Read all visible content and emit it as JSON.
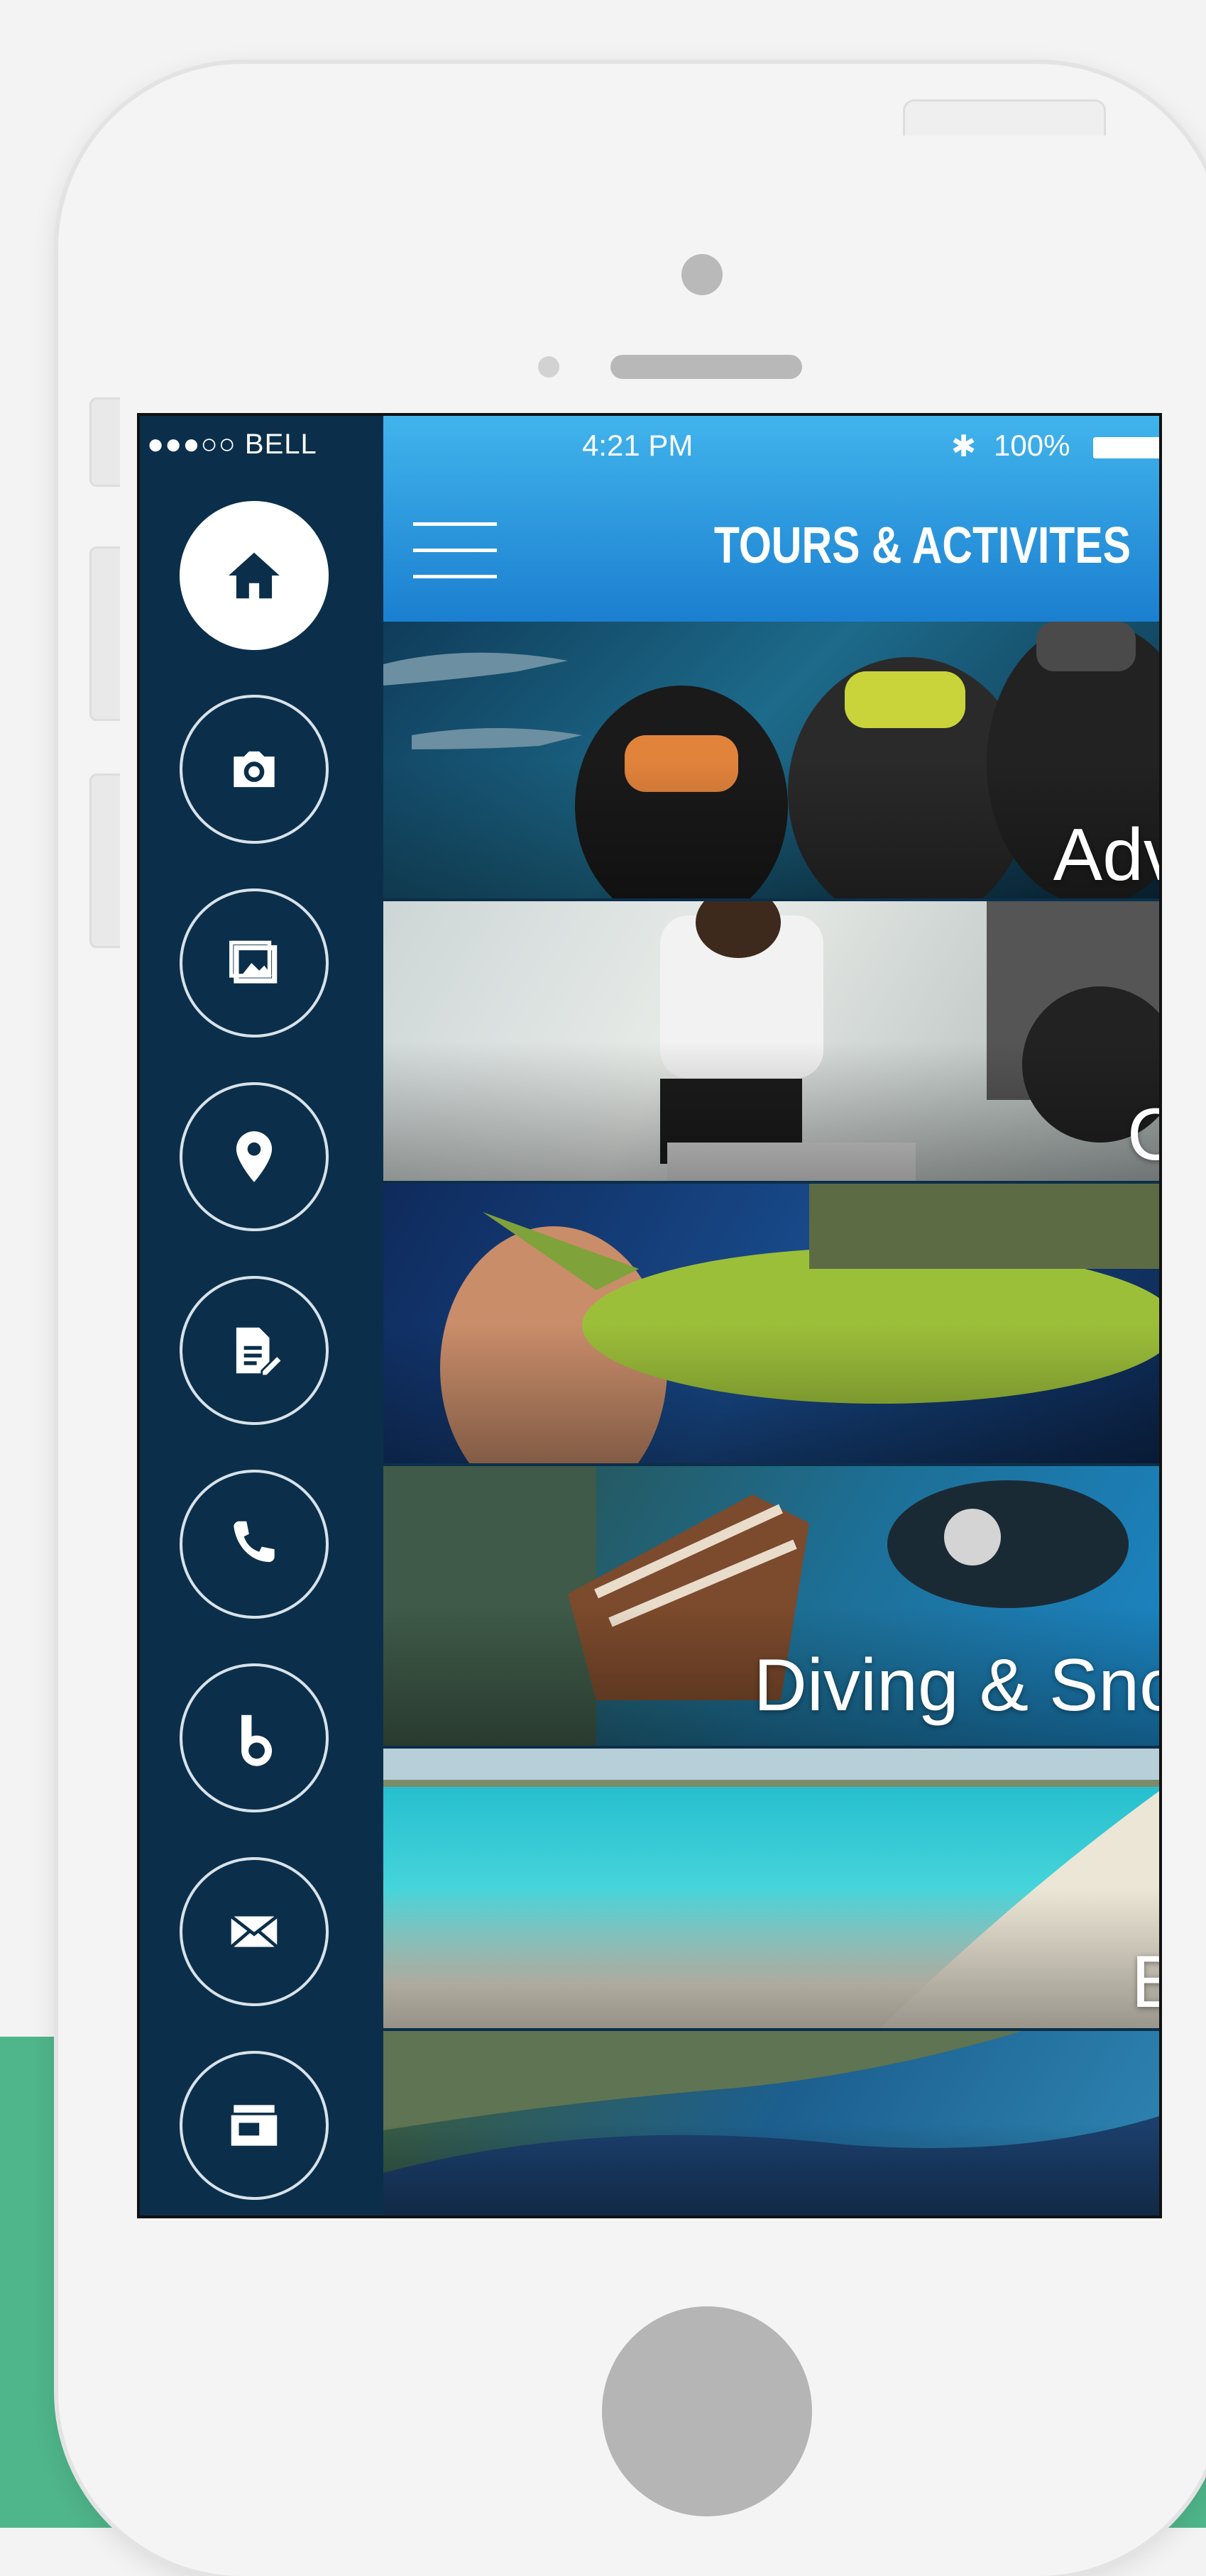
{
  "status": {
    "carrier": "●●●○○ BELL",
    "time": "4:21 PM",
    "battery": "100%"
  },
  "header": {
    "title": "TOURS & ACTIVITES"
  },
  "sidebar": {
    "items": [
      {
        "icon": "home-icon",
        "active": true
      },
      {
        "icon": "camera-icon"
      },
      {
        "icon": "gallery-icon"
      },
      {
        "icon": "map-pin-icon"
      },
      {
        "icon": "notes-icon"
      },
      {
        "icon": "phone-icon"
      },
      {
        "icon": "brand-icon"
      },
      {
        "icon": "mail-icon"
      },
      {
        "icon": "card-box-icon"
      }
    ]
  },
  "cards": [
    {
      "label": "Adv",
      "theme": "diving-sharks"
    },
    {
      "label": "C",
      "theme": "beach-fishing"
    },
    {
      "label": "",
      "theme": "mahi-fish"
    },
    {
      "label": "Diving & Sno",
      "theme": "lionfish"
    },
    {
      "label": "B",
      "theme": "beach"
    },
    {
      "label": "",
      "theme": "aerial-reef"
    }
  ],
  "colors": {
    "sidebar": "#0b2f4a",
    "header_top": "#41b4ec",
    "header_bottom": "#1b7fd0",
    "accent_green": "#4fb58a"
  }
}
